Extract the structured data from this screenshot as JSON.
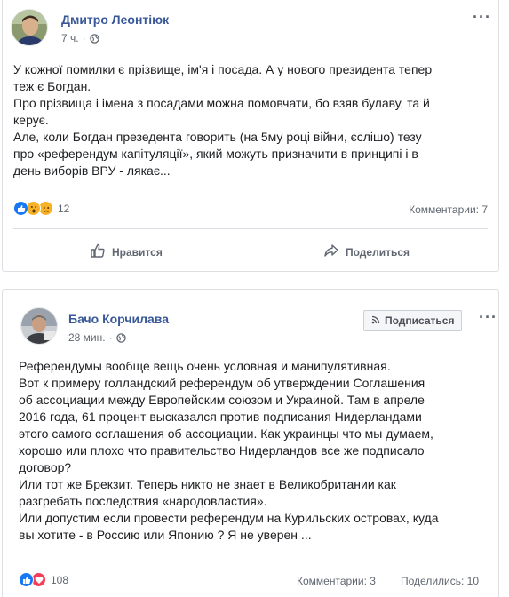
{
  "posts": [
    {
      "author": "Дмитро Леонтіюк",
      "time": "7 ч.",
      "text_lines": [
        "У кожної помилки є прізвище, ім'я і посада. А у нового президента тепер",
        "теж є Богдан.",
        "Про прізвища і імена з посадами можна помовчати, бо взяв булаву, та й",
        "керує.",
        "Але, коли Богдан презедента говорить (на 5му році війни, єслішо) тезу",
        "про «референдум капітуляції», який можуть призначити в принципі і в",
        "день виборів ВРУ - лякає..."
      ],
      "reactions": [
        "like-icon",
        "wow-icon",
        "sad-icon"
      ],
      "reaction_count": "12",
      "comments": "Комментарии: 7",
      "like_label": "Нравится",
      "share_label": "Поделиться"
    },
    {
      "author": "Бачо Корчилава",
      "time": "28 мин.",
      "subscribe_label": "Подписаться",
      "text_lines": [
        "Референдумы вообще вещь очень условная и манипулятивная.",
        "Вот к примеру голландский референдум об утверждении Соглашения",
        "об ассоциации между Европейским союзом и Украиной. Там в апреле",
        "2016 года, 61 процент высказался против подписания Нидерландами",
        "этого самого соглашения об ассоциации. Как украинцы что мы думаем,",
        "хорошо или плохо что правительство Нидерландов все же подписало",
        "договор?",
        "Или тот же Брекзит. Теперь никто не знает в Великобритании как",
        "разгребать последствия «народовластия».",
        "Или допустим если провести референдум на Курильских островах, куда",
        "вы хотите - в Россию или Японию ? Я не уверен ..."
      ],
      "reactions": [
        "like-icon",
        "love-icon"
      ],
      "reaction_count": "108",
      "comments": "Комментарии: 3",
      "shares": "Поделились: 10"
    }
  ],
  "colors": {
    "link_blue": "#385898",
    "secondary_text": "#606770",
    "like_blue": "#1877f2",
    "love_red": "#f33e58",
    "wow_yellow": "#f7b125"
  }
}
